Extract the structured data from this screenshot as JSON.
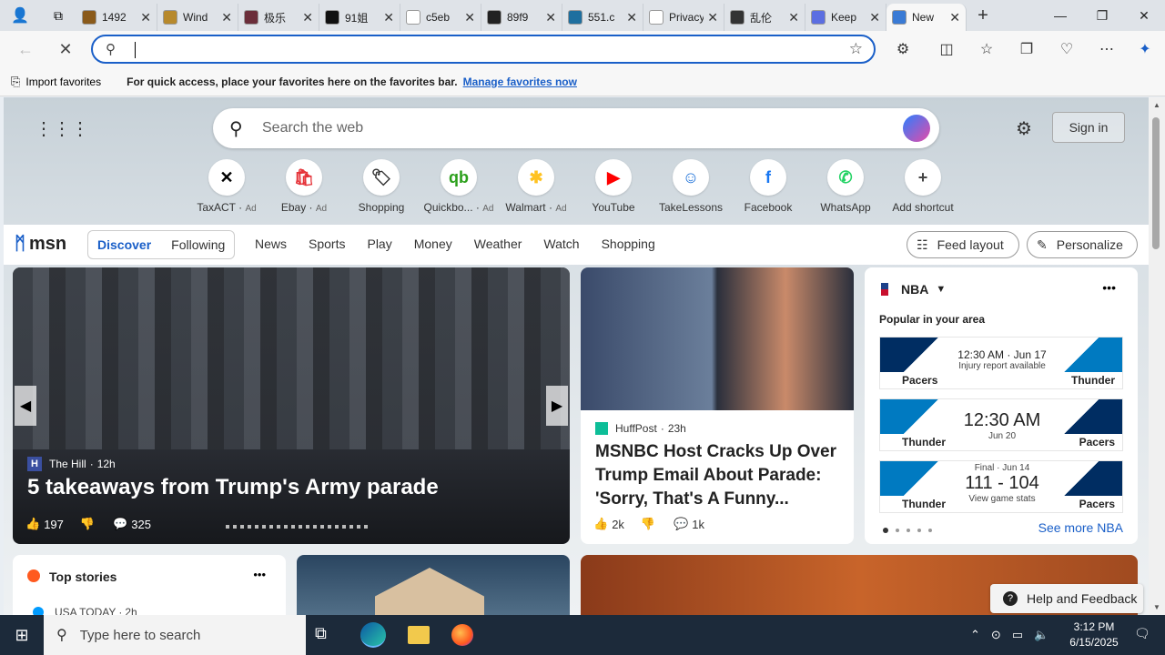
{
  "tabs": [
    {
      "title": "1492",
      "color": "#8a5a1a"
    },
    {
      "title": "Wind",
      "color": "#b7892c"
    },
    {
      "title": "极乐",
      "color": "#6b2e3a"
    },
    {
      "title": "91姐",
      "color": "#111111"
    },
    {
      "title": "c5eb",
      "color": "#ffffff"
    },
    {
      "title": "89f9",
      "color": "#222222"
    },
    {
      "title": "551.c",
      "color": "#1e6f9f"
    },
    {
      "title": "Privacy e",
      "color": "#ffffff"
    },
    {
      "title": "乱伦",
      "color": "#333333"
    },
    {
      "title": "Keep",
      "color": "#5b6ee1"
    },
    {
      "title": "New",
      "color": "#3a7bd5",
      "active": true
    }
  ],
  "window": {
    "minimize": "—",
    "restore": "❐",
    "close": "✕"
  },
  "favorites_bar": {
    "import_label": "Import favorites",
    "hint": "For quick access, place your favorites here on the favorites bar.",
    "manage_link": "Manage favorites now"
  },
  "search": {
    "placeholder": "Search the web"
  },
  "header": {
    "sign_in": "Sign in"
  },
  "shortcuts": [
    {
      "label": "TaxACT",
      "ad": "Ad",
      "glyph": "✕",
      "color": "#000000"
    },
    {
      "label": "Ebay",
      "ad": "Ad",
      "glyph": "🛍",
      "color": "#e53238"
    },
    {
      "label": "Shopping",
      "ad": "",
      "glyph": "🏷",
      "color": "#333333"
    },
    {
      "label": "Quickbo...",
      "ad": "Ad",
      "glyph": "qb",
      "color": "#2ca01c"
    },
    {
      "label": "Walmart",
      "ad": "Ad",
      "glyph": "✱",
      "color": "#ffc220"
    },
    {
      "label": "YouTube",
      "ad": "",
      "glyph": "▶",
      "color": "#ff0000"
    },
    {
      "label": "TakeLessons",
      "ad": "",
      "glyph": "☺",
      "color": "#1a6fd8"
    },
    {
      "label": "Facebook",
      "ad": "",
      "glyph": "f",
      "color": "#1877f2"
    },
    {
      "label": "WhatsApp",
      "ad": "",
      "glyph": "✆",
      "color": "#25d366"
    },
    {
      "label": "Add shortcut",
      "ad": "",
      "glyph": "+",
      "color": "#444444"
    }
  ],
  "nav": {
    "brand": "msn",
    "tabs": [
      "Discover",
      "Following"
    ],
    "links": [
      "News",
      "Sports",
      "Play",
      "Money",
      "Weather",
      "Watch",
      "Shopping"
    ],
    "feed_layout": "Feed layout",
    "personalize": "Personalize"
  },
  "hero": {
    "source": "The Hill",
    "age": "12h",
    "headline": "5 takeaways from Trump's Army parade",
    "likes": "197",
    "comments": "325"
  },
  "story2": {
    "source": "HuffPost",
    "age": "23h",
    "headline": "MSNBC Host Cracks Up Over Trump Email About Parade: 'Sorry, That's A Funny...",
    "likes": "2k",
    "comments": "1k"
  },
  "nba": {
    "title": "NBA",
    "subtitle": "Popular in your area",
    "games": [
      {
        "left": "Pacers",
        "right": "Thunder",
        "main": "12:30 AM · Jun 17",
        "sub": "Injury report available",
        "big": false
      },
      {
        "left": "Thunder",
        "right": "Pacers",
        "main": "12:30 AM",
        "sub": "Jun 20",
        "big": true
      },
      {
        "left": "Thunder",
        "right": "Pacers",
        "main": "111 - 104",
        "top": "Final · Jun 14",
        "sub": "View game stats",
        "big": true
      }
    ],
    "see_more": "See more NBA"
  },
  "top_stories": {
    "title": "Top stories",
    "first_source": "USA TODAY",
    "first_age": "2h"
  },
  "feedback": "Help and Feedback",
  "taskbar": {
    "search_placeholder": "Type here to search",
    "time": "3:12 PM",
    "date": "6/15/2025"
  },
  "colors": {
    "accent": "#1a5fc8",
    "pacers": "#002d62",
    "thunder": "#007ac1"
  }
}
